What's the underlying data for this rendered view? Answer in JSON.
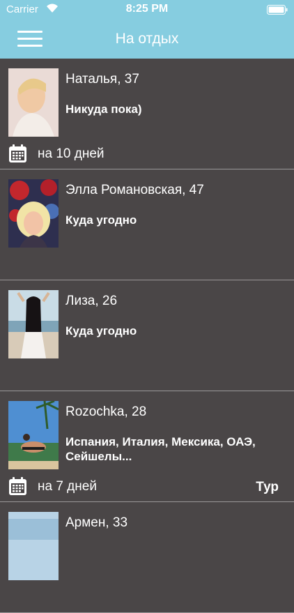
{
  "status_bar": {
    "carrier": "Carrier",
    "time": "8:25 PM"
  },
  "header": {
    "title": "На отдых"
  },
  "accent_color": "#86cde0",
  "background_color": "#4a4647",
  "profiles": [
    {
      "name": "Наталья, 37",
      "destination": "Никуда пока)",
      "duration": "на 10 дней",
      "tag": ""
    },
    {
      "name": "Элла Романовская, 47",
      "destination": "Куда угодно",
      "duration": "",
      "tag": ""
    },
    {
      "name": "Лиза, 26",
      "destination": "Куда угодно",
      "duration": "",
      "tag": ""
    },
    {
      "name": "Rozochka, 28",
      "destination": "Испания, Италия, Мексика, ОАЭ, Сейшелы...",
      "duration": "на 7 дней",
      "tag": "Тур"
    },
    {
      "name": "Армен, 33",
      "destination": "",
      "duration": "",
      "tag": ""
    }
  ]
}
